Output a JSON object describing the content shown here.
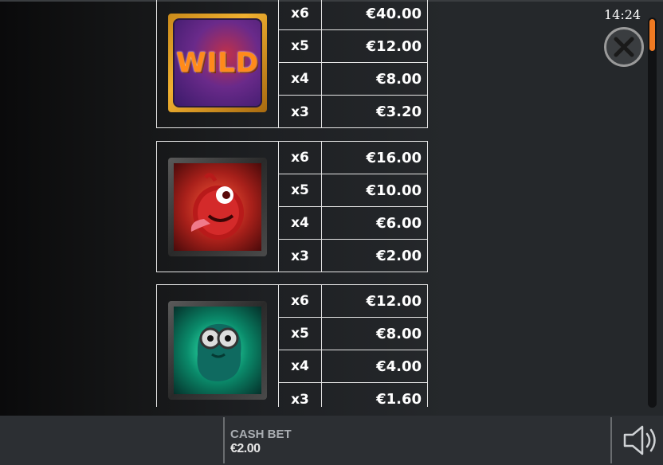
{
  "clock": "14:24",
  "paytable": [
    {
      "symbol": "wild",
      "symbol_text": "WILD",
      "rows": [
        {
          "mult": "x6",
          "amount": "€40.00"
        },
        {
          "mult": "x5",
          "amount": "€12.00"
        },
        {
          "mult": "x4",
          "amount": "€8.00"
        },
        {
          "mult": "x3",
          "amount": "€3.20"
        }
      ]
    },
    {
      "symbol": "red-monster",
      "rows": [
        {
          "mult": "x6",
          "amount": "€16.00"
        },
        {
          "mult": "x5",
          "amount": "€10.00"
        },
        {
          "mult": "x4",
          "amount": "€6.00"
        },
        {
          "mult": "x3",
          "amount": "€2.00"
        }
      ]
    },
    {
      "symbol": "green-monster",
      "rows": [
        {
          "mult": "x6",
          "amount": "€12.00"
        },
        {
          "mult": "x5",
          "amount": "€8.00"
        },
        {
          "mult": "x4",
          "amount": "€4.00"
        },
        {
          "mult": "x3",
          "amount": "€1.60"
        }
      ]
    }
  ],
  "footer": {
    "bet_label": "CASH BET",
    "bet_value": "€2.00"
  },
  "icons": {
    "close": "close-icon",
    "sound": "speaker-icon"
  },
  "colors": {
    "scroll_accent": "#f07a22",
    "wild_text": "#ff8a1a"
  }
}
